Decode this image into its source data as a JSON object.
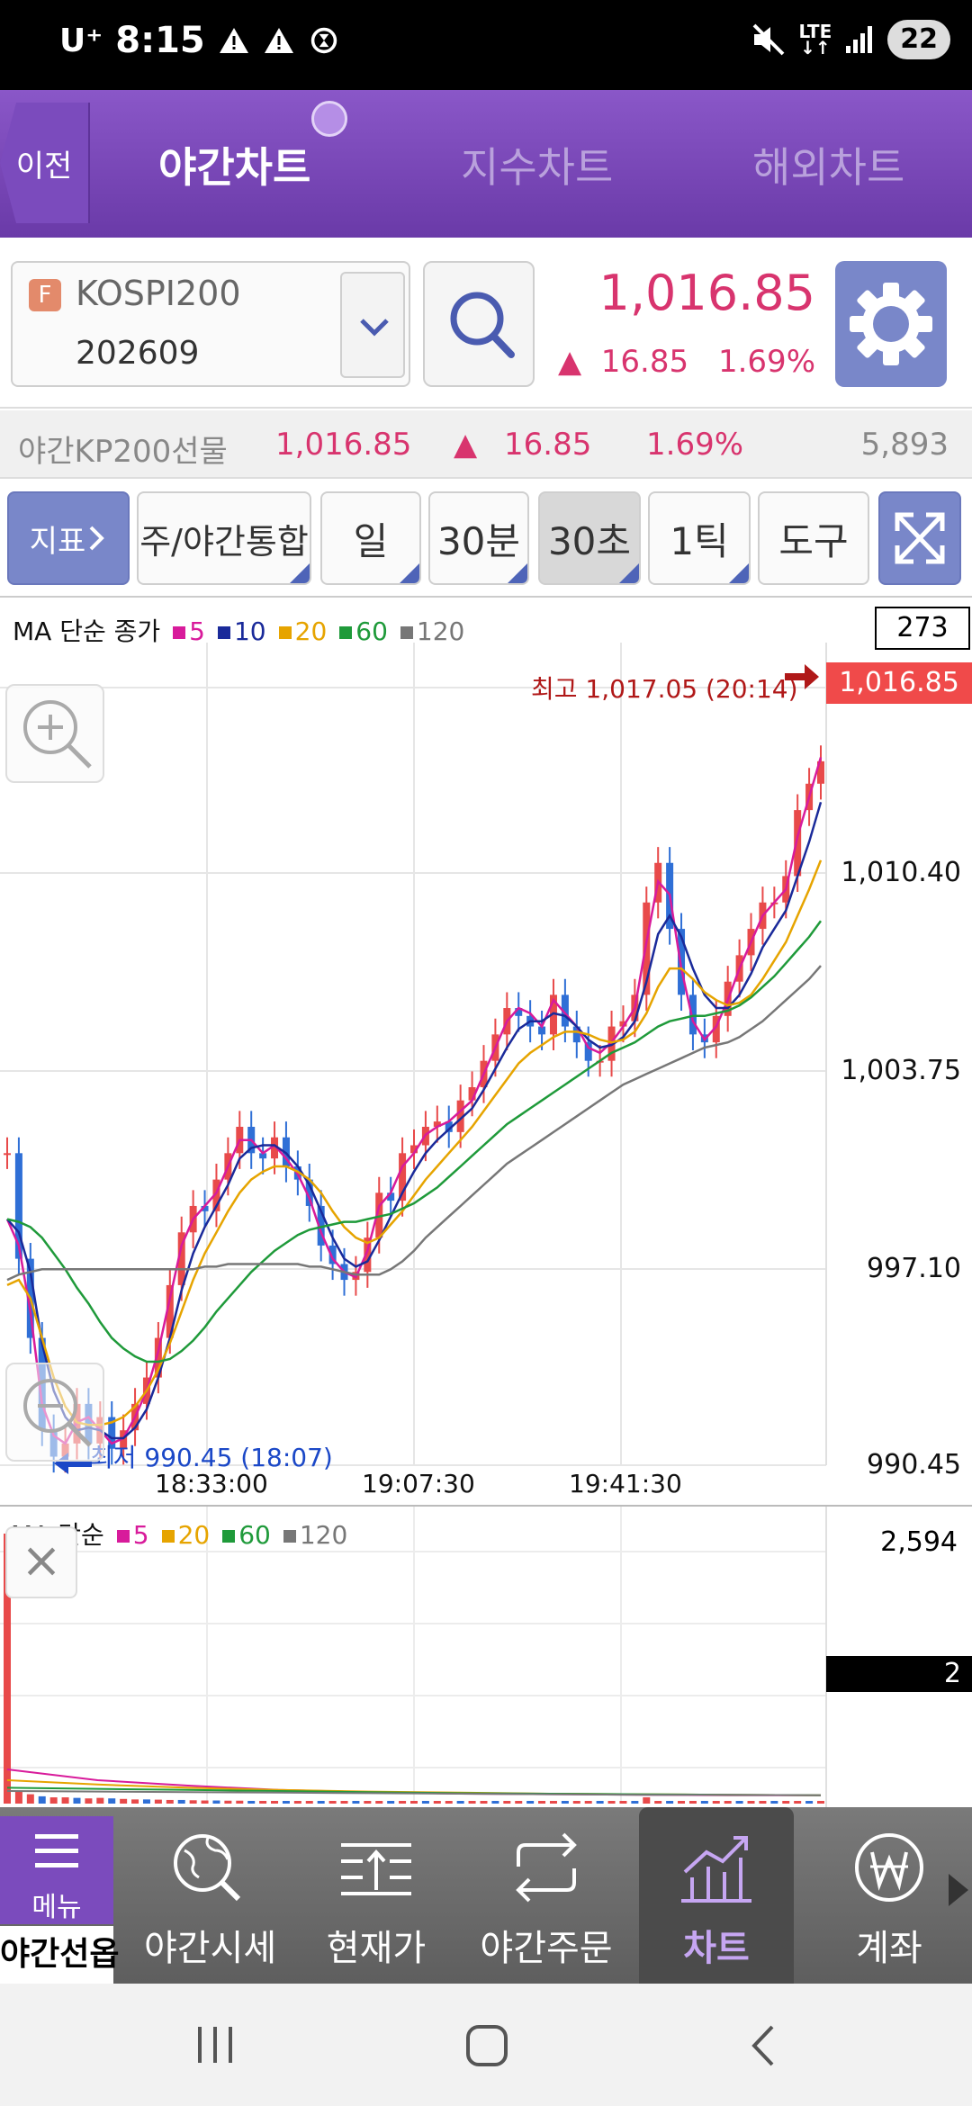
{
  "status_bar": {
    "carrier": "U⁺",
    "time": "8:15",
    "network": "LTE",
    "battery": "22"
  },
  "header": {
    "back_label": "이전",
    "tabs": [
      {
        "label": "야간차트",
        "active": true
      },
      {
        "label": "지수차트",
        "active": false
      },
      {
        "label": "해외차트",
        "active": false
      }
    ]
  },
  "symbol": {
    "badge": "F",
    "name": "KOSPI200",
    "code": "202609",
    "price": "1,016.85",
    "change_arrow": "▲",
    "change": "16.85",
    "change_pct": "1.69%",
    "up_color": "#d8346e"
  },
  "ticker": {
    "name": "야간KP200선물",
    "price": "1,016.85",
    "arrow": "▲",
    "change": "16.85",
    "change_pct": "1.69%",
    "volume": "5,893"
  },
  "toolbar": {
    "indicator": "지표",
    "combined": "주/야간통합",
    "day": "일",
    "min30": "30분",
    "sec30": "30초",
    "tick1": "1틱",
    "tool": "도구"
  },
  "chart": {
    "legend_main": {
      "title": "MA 단순 종가",
      "items": [
        {
          "label": "5",
          "color": "#d81b9b"
        },
        {
          "label": "10",
          "color": "#1a2a9a"
        },
        {
          "label": "20",
          "color": "#e6a400"
        },
        {
          "label": "60",
          "color": "#1f9a3a"
        },
        {
          "label": "120",
          "color": "#777777"
        }
      ]
    },
    "legend_sub": {
      "title": "MA 단순",
      "items": [
        {
          "label": "5",
          "color": "#d81b9b"
        },
        {
          "label": "20",
          "color": "#e6a400"
        },
        {
          "label": "60",
          "color": "#1f9a3a"
        },
        {
          "label": "120",
          "color": "#777777"
        }
      ]
    },
    "count": "273",
    "last_price_tag": "1,016.85",
    "high_label": "최고 1,017.05 (20:14)",
    "low_label": "최저 990.45 (18:07)",
    "y_labels": [
      "1,010.40",
      "1,003.75",
      "997.10",
      "990.45"
    ],
    "x_labels": [
      "18:33:00",
      "19:07:30",
      "19:41:30"
    ],
    "volume_max": "2,594",
    "volume_tag": "2"
  },
  "chart_data": {
    "type": "line",
    "title": "",
    "ylim": [
      990.45,
      1017.05
    ],
    "series": [
      {
        "name": "5",
        "values": [
          999.5,
          998.5,
          996.0,
          992.5,
          991.3,
          991.0,
          991.8,
          992.0,
          991.5,
          991.0,
          991.2,
          992.0,
          993.0,
          994.5,
          996.5,
          998.5,
          999.5,
          1000.0,
          1000.5,
          1001.5,
          1002.5,
          1002.5,
          1002.0,
          1002.3,
          1001.8,
          1001.2,
          1000.3,
          999.0,
          998.0,
          997.5,
          997.3,
          998.3,
          1000.0,
          1000.5,
          1001.5,
          1002.0,
          1002.7,
          1003.0,
          1003.2,
          1003.6,
          1004.0,
          1005.0,
          1006.0,
          1007.0,
          1007.5,
          1007.3,
          1006.8,
          1007.8,
          1007.3,
          1006.8,
          1006.0,
          1005.8,
          1006.2,
          1006.8,
          1007.5,
          1010.0,
          1012.3,
          1011.8,
          1009.0,
          1007.0,
          1006.3,
          1006.8,
          1007.8,
          1009.0,
          1010.0,
          1011.0,
          1011.5,
          1012.0,
          1014.0,
          1015.5,
          1017.0
        ]
      },
      {
        "name": "10",
        "values": [
          999.5,
          999.0,
          997.5,
          994.8,
          993.0,
          992.0,
          991.5,
          991.6,
          991.5,
          991.2,
          991.2,
          991.6,
          992.3,
          993.5,
          995.0,
          996.8,
          998.2,
          999.2,
          1000.0,
          1000.8,
          1001.8,
          1002.2,
          1002.3,
          1002.3,
          1002.0,
          1001.5,
          1000.8,
          999.8,
          998.8,
          998.0,
          997.7,
          997.9,
          998.7,
          999.6,
          1000.5,
          1001.3,
          1002.0,
          1002.5,
          1002.9,
          1003.3,
          1003.7,
          1004.4,
          1005.2,
          1006.0,
          1006.7,
          1007.0,
          1007.0,
          1007.3,
          1007.2,
          1006.8,
          1006.3,
          1006.0,
          1006.1,
          1006.4,
          1007.0,
          1008.5,
          1010.3,
          1011.0,
          1010.2,
          1009.0,
          1008.0,
          1007.5,
          1007.5,
          1008.0,
          1008.8,
          1009.8,
          1010.5,
          1011.2,
          1012.5,
          1013.8,
          1015.3
        ]
      },
      {
        "name": "20",
        "values": [
          997.0,
          997.2,
          996.5,
          995.0,
          993.5,
          992.4,
          991.8,
          991.7,
          991.7,
          991.8,
          992.0,
          992.4,
          993.0,
          993.8,
          994.8,
          996.0,
          997.2,
          998.2,
          999.0,
          999.8,
          1000.5,
          1001.0,
          1001.3,
          1001.5,
          1001.5,
          1001.3,
          1001.0,
          1000.5,
          999.8,
          999.2,
          998.8,
          998.6,
          998.8,
          999.3,
          999.8,
          1000.4,
          1001.0,
          1001.5,
          1002.0,
          1002.5,
          1003.0,
          1003.6,
          1004.2,
          1004.8,
          1005.4,
          1005.8,
          1006.1,
          1006.4,
          1006.6,
          1006.6,
          1006.5,
          1006.3,
          1006.2,
          1006.3,
          1006.6,
          1007.3,
          1008.3,
          1009.0,
          1009.0,
          1008.6,
          1008.1,
          1007.8,
          1007.6,
          1007.7,
          1008.0,
          1008.6,
          1009.3,
          1010.0,
          1011.0,
          1012.0,
          1013.1
        ]
      },
      {
        "name": "60",
        "values": [
          999.5,
          999.4,
          999.2,
          998.8,
          998.2,
          997.6,
          996.9,
          996.3,
          995.6,
          995.0,
          994.6,
          994.3,
          994.1,
          994.1,
          994.2,
          994.5,
          994.9,
          995.4,
          996.0,
          996.5,
          997.0,
          997.5,
          997.9,
          998.3,
          998.6,
          998.9,
          999.1,
          999.2,
          999.3,
          999.4,
          999.4,
          999.5,
          999.6,
          999.7,
          999.9,
          1000.1,
          1000.4,
          1000.7,
          1001.1,
          1001.5,
          1001.9,
          1002.3,
          1002.7,
          1003.1,
          1003.4,
          1003.7,
          1004.0,
          1004.3,
          1004.6,
          1004.9,
          1005.2,
          1005.5,
          1005.8,
          1006.0,
          1006.2,
          1006.5,
          1006.8,
          1007.0,
          1007.1,
          1007.2,
          1007.2,
          1007.3,
          1007.4,
          1007.6,
          1007.9,
          1008.3,
          1008.7,
          1009.2,
          1009.7,
          1010.2,
          1010.8
        ]
      },
      {
        "name": "120",
        "values": [
          997.2,
          997.4,
          997.5,
          997.6,
          997.6,
          997.6,
          997.6,
          997.6,
          997.6,
          997.6,
          997.6,
          997.6,
          997.6,
          997.6,
          997.6,
          997.6,
          997.6,
          997.7,
          997.7,
          997.8,
          997.8,
          997.8,
          997.8,
          997.8,
          997.8,
          997.8,
          997.7,
          997.7,
          997.6,
          997.5,
          997.4,
          997.4,
          997.4,
          997.6,
          997.9,
          998.3,
          998.8,
          999.2,
          999.6,
          1000.0,
          1000.4,
          1000.8,
          1001.2,
          1001.6,
          1001.9,
          1002.2,
          1002.5,
          1002.8,
          1003.1,
          1003.4,
          1003.7,
          1004.0,
          1004.3,
          1004.6,
          1004.8,
          1005.0,
          1005.2,
          1005.4,
          1005.6,
          1005.8,
          1006.0,
          1006.1,
          1006.2,
          1006.4,
          1006.7,
          1007.0,
          1007.4,
          1007.8,
          1008.2,
          1008.6,
          1009.1
        ]
      }
    ],
    "price_series": [
      1002.0,
      998.0,
      995.0,
      991.5,
      990.5,
      991.0,
      992.5,
      991.0,
      992.0,
      990.8,
      991.5,
      992.5,
      993.5,
      995.0,
      997.0,
      999.0,
      1000.0,
      999.8,
      1001.0,
      1002.0,
      1003.0,
      1002.0,
      1001.8,
      1002.6,
      1001.5,
      1001.0,
      1000.0,
      998.5,
      997.8,
      997.2,
      997.5,
      998.8,
      1000.5,
      1000.2,
      1002.0,
      1002.3,
      1003.0,
      1003.2,
      1002.8,
      1004.0,
      1004.5,
      1005.5,
      1006.5,
      1007.5,
      1007.2,
      1006.8,
      1006.5,
      1008.0,
      1006.8,
      1006.2,
      1005.5,
      1005.5,
      1006.8,
      1007.0,
      1008.0,
      1011.5,
      1013.0,
      1010.5,
      1008.0,
      1006.5,
      1006.2,
      1007.2,
      1008.5,
      1009.5,
      1010.5,
      1011.5,
      1011.5,
      1012.5,
      1015.0,
      1016.0,
      1016.85
    ],
    "x_labels": [
      "18:33:00",
      "19:07:30",
      "19:41:30"
    ],
    "high": {
      "value": 1017.05,
      "time": "20:14"
    },
    "low": {
      "value": 990.45,
      "time": "18:07"
    },
    "volume": {
      "max": 2594,
      "values": [
        2594,
        120,
        90,
        70,
        60,
        60,
        55,
        50,
        55,
        50,
        45,
        40,
        40,
        38,
        35,
        35,
        32,
        30,
        30,
        28,
        28,
        26,
        25,
        25,
        24,
        22,
        22,
        22,
        20,
        20,
        20,
        18,
        18,
        18,
        18,
        18,
        16,
        16,
        16,
        16,
        15,
        15,
        15,
        15,
        14,
        14,
        14,
        14,
        14,
        14,
        14,
        13,
        13,
        13,
        13,
        60,
        20,
        12,
        12,
        12,
        12,
        12,
        12,
        12,
        12,
        12,
        12,
        12,
        12,
        12,
        12
      ]
    }
  },
  "bottom_nav": {
    "menu": "메뉴",
    "items": [
      {
        "label": "야간선옵"
      },
      {
        "label": "야간시세"
      },
      {
        "label": "현재가"
      },
      {
        "label": "야간주문"
      },
      {
        "label": "차트"
      },
      {
        "label": "계좌"
      }
    ]
  }
}
